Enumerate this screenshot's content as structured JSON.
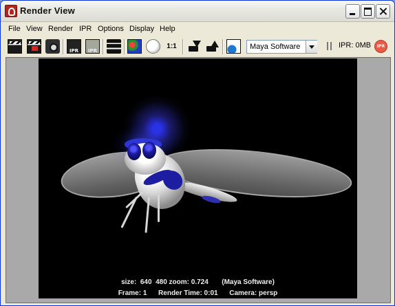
{
  "window": {
    "title": "Render View"
  },
  "menu": {
    "items": [
      "File",
      "View",
      "Render",
      "IPR",
      "Options",
      "Display",
      "Help"
    ]
  },
  "toolbar": {
    "renderer": "Maya Software",
    "scale_label": "1:1",
    "ipr_memory": "IPR: 0MB",
    "ipr_badge": "IPR",
    "tool_icons": [
      "redo-render-icon",
      "render-region-icon",
      "snapshot-icon",
      "ipr-render-icon",
      "refresh-ipr-icon",
      "display-channels-icon",
      "rgb-channels-icon",
      "alpha-channel-icon",
      "real-size-icon",
      "keep-image-icon",
      "remove-image-icon",
      "render-settings-icon"
    ]
  },
  "render": {
    "info_line_1": "size:  640  480 zoom: 0.724       (Maya Software)",
    "info_line_2": "Frame: 1      Render Time: 0:01      Camera: persp"
  }
}
